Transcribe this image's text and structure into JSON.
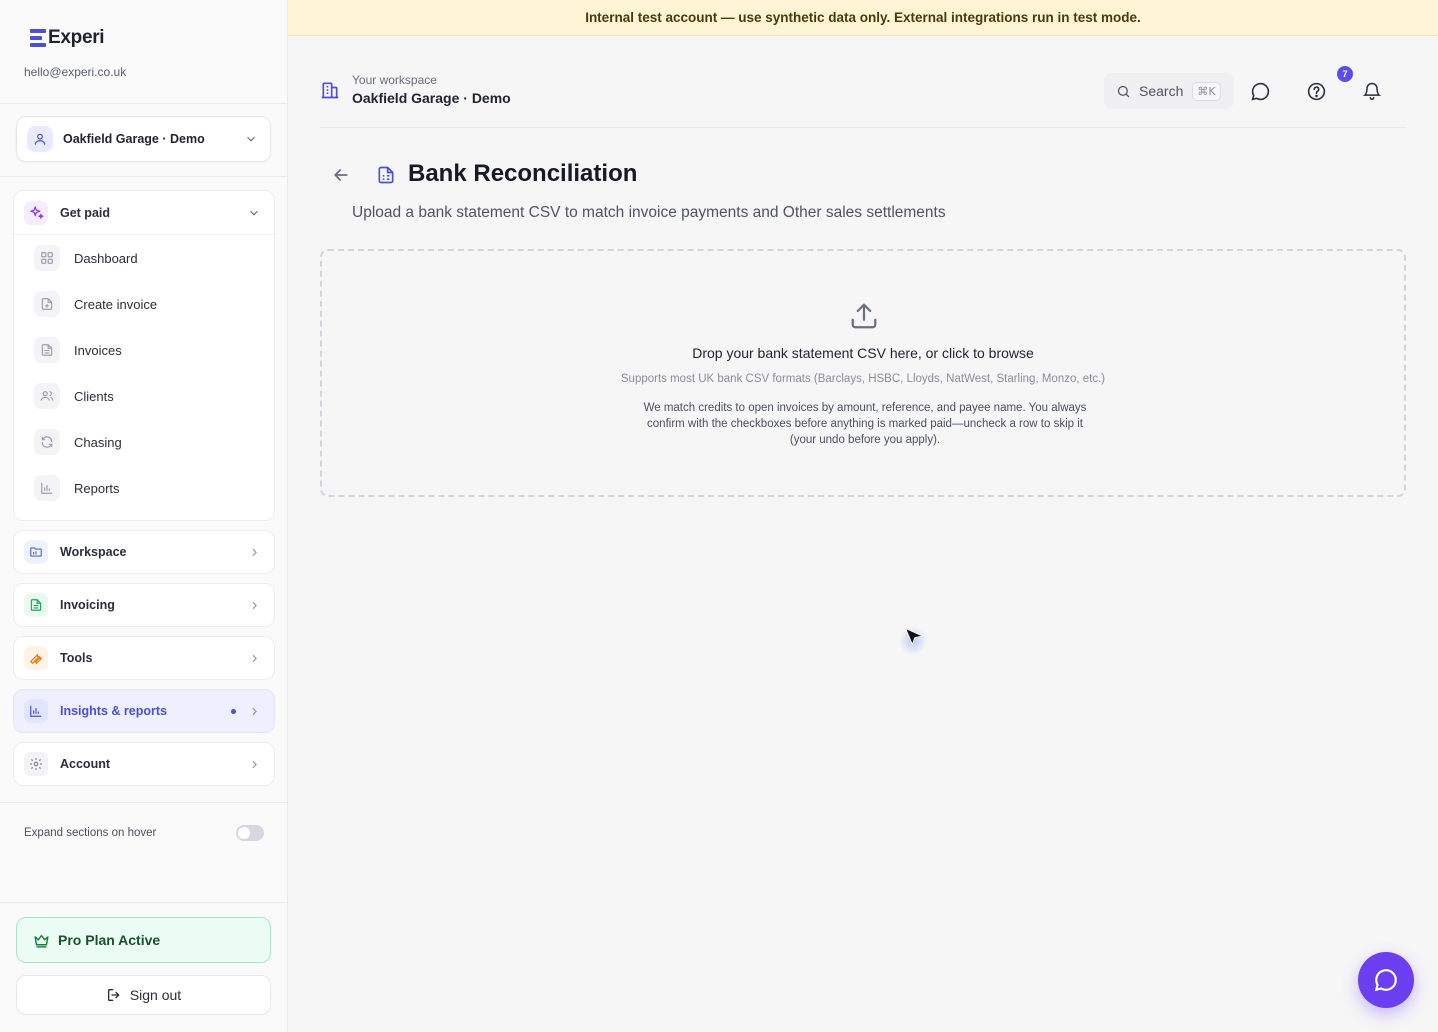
{
  "brand": {
    "name": "Experi",
    "email": "hello@experi.co.uk"
  },
  "workspace_select": {
    "name": "Oakfield Garage · Demo"
  },
  "sidebar": {
    "get_paid": {
      "title": "Get paid",
      "items": [
        {
          "label": "Dashboard",
          "icon": "grid-icon"
        },
        {
          "label": "Create invoice",
          "icon": "file-plus-icon"
        },
        {
          "label": "Invoices",
          "icon": "file-text-icon"
        },
        {
          "label": "Clients",
          "icon": "users-icon"
        },
        {
          "label": "Chasing",
          "icon": "refresh-icon"
        },
        {
          "label": "Reports",
          "icon": "bar-chart-icon"
        }
      ]
    },
    "sections": [
      {
        "label": "Workspace",
        "icon": "folder-icon"
      },
      {
        "label": "Invoicing",
        "icon": "document-icon"
      },
      {
        "label": "Tools",
        "icon": "wrench-icon"
      },
      {
        "label": "Insights & reports",
        "icon": "bar-chart-icon",
        "active": true
      },
      {
        "label": "Account",
        "icon": "gear-icon"
      }
    ],
    "hover_toggle_label": "Expand sections on hover",
    "pro_plan": "Pro Plan Active",
    "sign_out": "Sign out"
  },
  "banner": {
    "text": "Internal test account — use synthetic data only. External integrations run in test mode."
  },
  "header": {
    "caption": "Your workspace",
    "workspace": "Oakfield Garage · Demo",
    "search_label": "Search",
    "search_shortcut": "⌘K",
    "help_badge": "7"
  },
  "page": {
    "title": "Bank Reconciliation",
    "subtitle": "Upload a bank statement CSV to match invoice payments and Other sales settlements"
  },
  "dropzone": {
    "title": "Drop your bank statement CSV here, or click to browse",
    "formats": "Supports most UK bank CSV formats (Barclays, HSBC, Lloyds, NatWest, Starling, Monzo, etc.)",
    "note": "We match credits to open invoices by amount, reference, and payee name. You always confirm with the checkboxes before anything is marked paid—uncheck a row to skip it (your undo before you apply)."
  },
  "colors": {
    "accent": "#4b4fd8",
    "banner": "#fdf5d6",
    "pro": "#ecfdf5",
    "fab": "#6b3ef0"
  }
}
